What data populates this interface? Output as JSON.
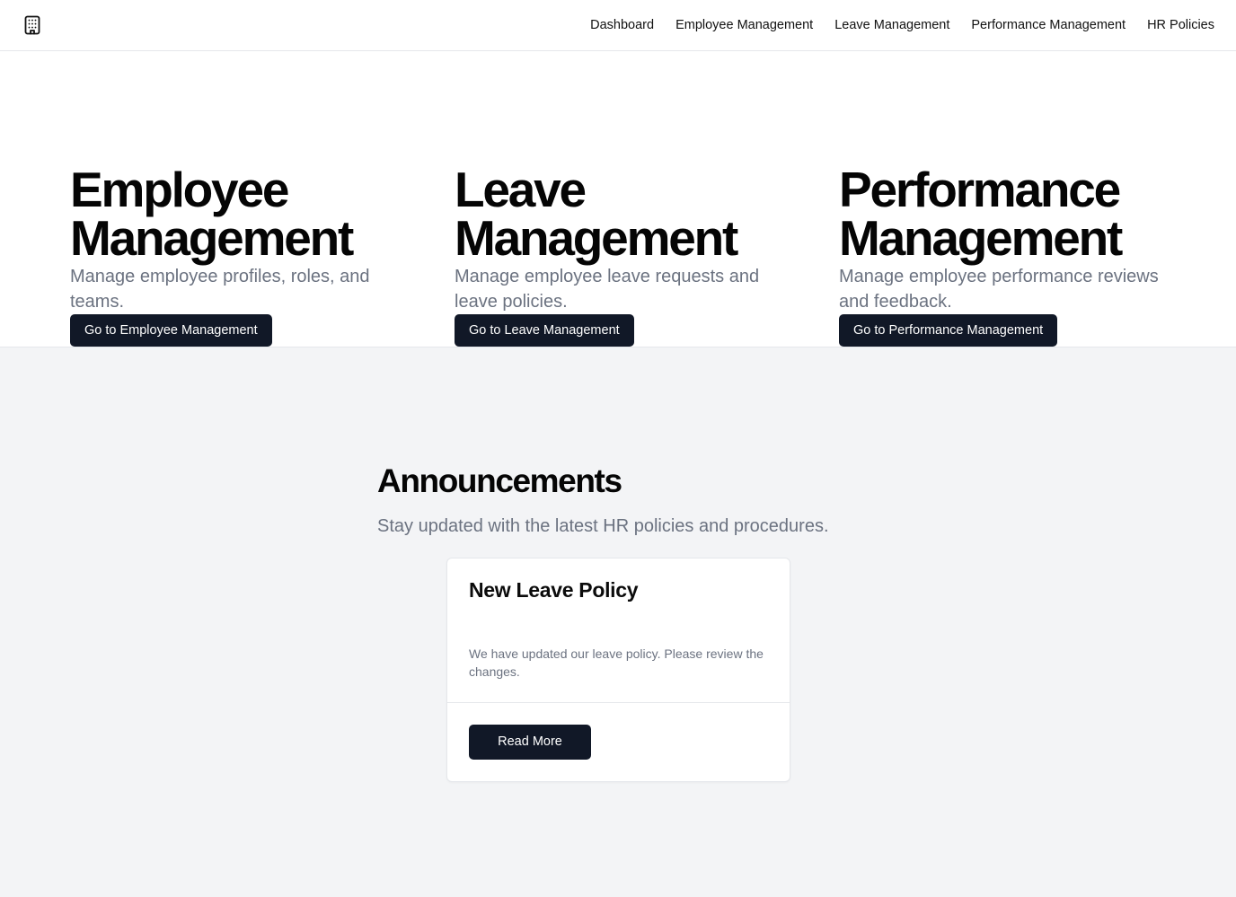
{
  "header": {
    "logo_icon": "building-icon",
    "nav": [
      {
        "label": "Dashboard"
      },
      {
        "label": "Employee Management"
      },
      {
        "label": "Leave Management"
      },
      {
        "label": "Performance Management"
      },
      {
        "label": "HR Policies"
      }
    ]
  },
  "hero": {
    "cards": [
      {
        "title_line1": "Employee",
        "title_line2": "Management",
        "description": "Manage employee profiles, roles, and teams.",
        "button": "Go to Employee Management"
      },
      {
        "title_line1": "Leave",
        "title_line2": "Management",
        "description": "Manage employee leave requests and leave policies.",
        "button": "Go to Leave Management"
      },
      {
        "title_line1": "Performance",
        "title_line2": "Management",
        "description": "Manage employee performance reviews and feedback.",
        "button": "Go to Performance Management"
      }
    ]
  },
  "announcements": {
    "title": "Announcements",
    "subtitle": "Stay updated with the latest HR policies and procedures.",
    "items": [
      {
        "title": "New Leave Policy",
        "body": "We have updated our leave policy. Please review the changes.",
        "button": "Read More"
      }
    ]
  },
  "colors": {
    "primary_button": "#111827",
    "muted_text": "#6b7280",
    "section_bg": "#f3f4f6",
    "border": "#e5e7eb"
  }
}
